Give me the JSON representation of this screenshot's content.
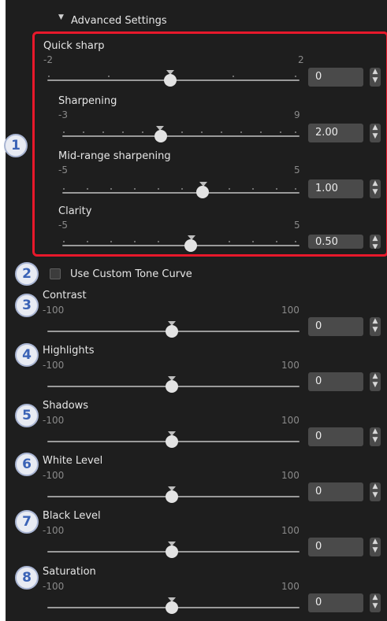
{
  "section": {
    "arrow": "▼",
    "title": "Advanced Settings"
  },
  "sharp": [
    {
      "label": "Quick sharp",
      "min": "-2",
      "max": "2",
      "value": "0"
    },
    {
      "label": "Sharpening",
      "min": "-3",
      "max": "9",
      "value": "2.00"
    },
    {
      "label": "Mid-range sharpening",
      "min": "-5",
      "max": "5",
      "value": "1.00"
    },
    {
      "label": "Clarity",
      "min": "-5",
      "max": "5",
      "value": "0.50"
    }
  ],
  "tone_curve": {
    "label": "Use Custom Tone Curve",
    "checked": false
  },
  "sliders": [
    {
      "label": "Contrast",
      "min": "-100",
      "max": "100",
      "value": "0"
    },
    {
      "label": "Highlights",
      "min": "-100",
      "max": "100",
      "value": "0"
    },
    {
      "label": "Shadows",
      "min": "-100",
      "max": "100",
      "value": "0"
    },
    {
      "label": "White Level",
      "min": "-100",
      "max": "100",
      "value": "0"
    },
    {
      "label": "Black Level",
      "min": "-100",
      "max": "100",
      "value": "0"
    },
    {
      "label": "Saturation",
      "min": "-100",
      "max": "100",
      "value": "0"
    }
  ],
  "callouts": [
    "1",
    "2",
    "3",
    "4",
    "5",
    "6",
    "7",
    "8"
  ],
  "spin_glyphs": {
    "up": "▲",
    "down": "▼"
  },
  "colors": {
    "highlight_box": "#e8182b",
    "callout_text": "#3b63b6",
    "panel_bg": "#1e1e1e"
  }
}
